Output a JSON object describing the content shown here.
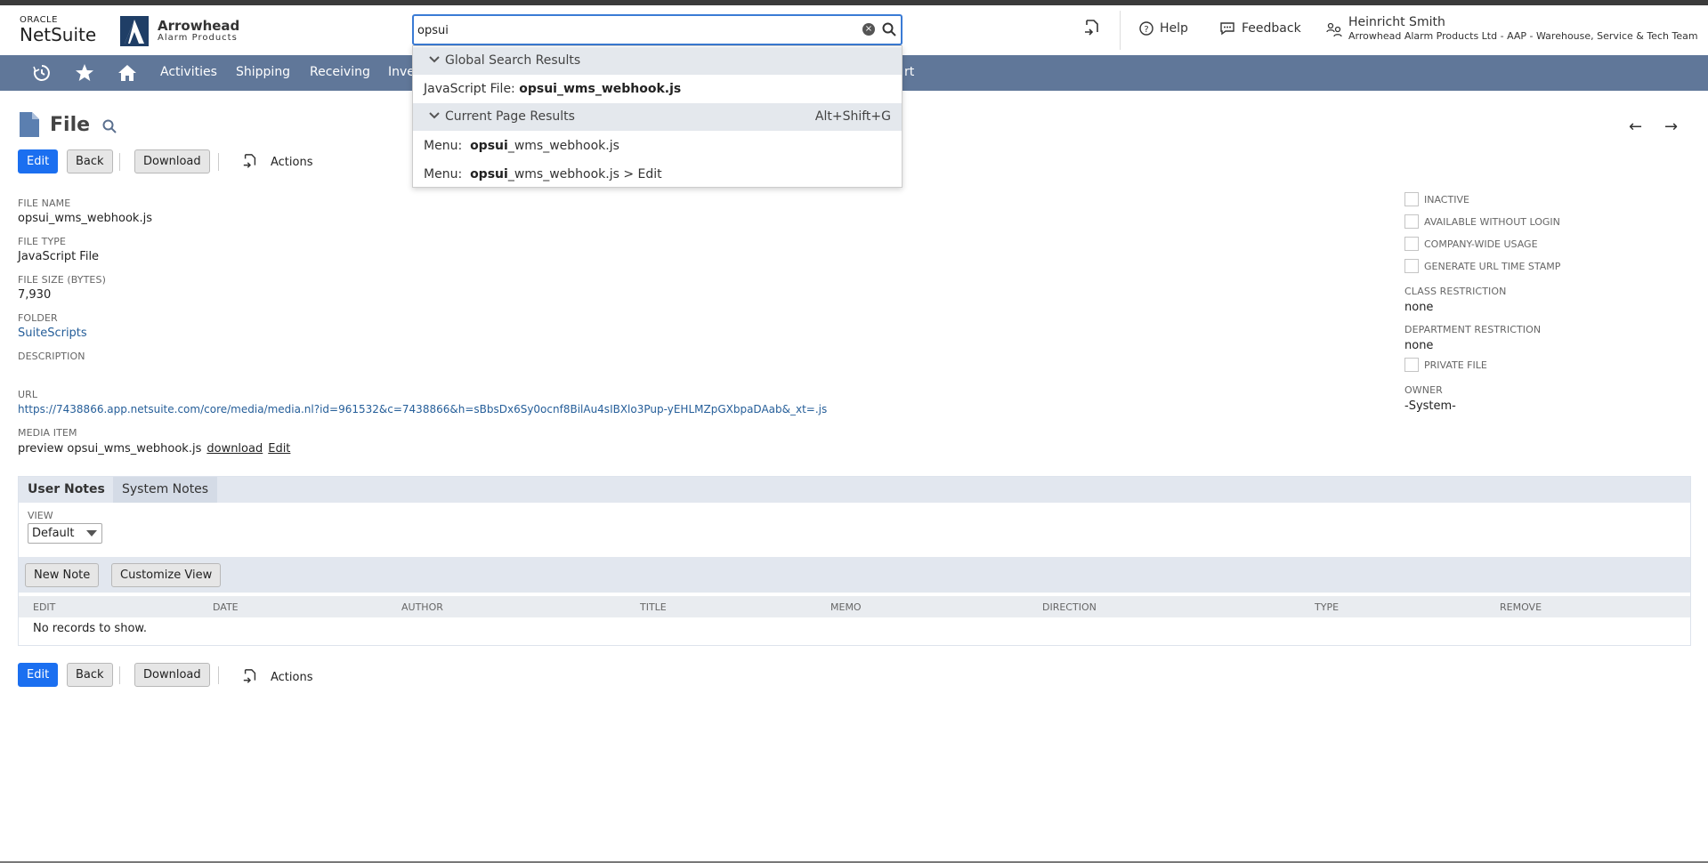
{
  "brand": {
    "oracle": "ORACLE",
    "netsuite": "NetSuite",
    "company_name": "Arrowhead",
    "company_sub": "Alarm Products"
  },
  "search": {
    "value": "opsui"
  },
  "header": {
    "help": "Help",
    "feedback": "Feedback",
    "user_name": "Heinricht Smith",
    "user_role": "Arrowhead Alarm Products Ltd - AAP - Warehouse, Service & Tech Team"
  },
  "nav": {
    "items": [
      "Activities",
      "Shipping",
      "Receiving",
      "Inve",
      "rt"
    ]
  },
  "dropdown": {
    "global_title": "Global Search Results",
    "global_item_prefix": "JavaScript File: ",
    "global_item_bold": "opsui_wms_webhook.js",
    "current_title": "Current Page Results",
    "current_shortcut": "Alt+Shift+G",
    "item1_prefix": "Menu: ",
    "item1_bold": "opsui",
    "item1_rest": "_wms_webhook.js",
    "item2_prefix": "Menu: ",
    "item2_bold": "opsui",
    "item2_rest": "_wms_webhook.js > Edit"
  },
  "page": {
    "title": "File"
  },
  "toolbar": {
    "edit": "Edit",
    "back": "Back",
    "download": "Download",
    "actions": "Actions"
  },
  "fields": {
    "file_name_label": "FILE NAME",
    "file_name": "opsui_wms_webhook.js",
    "file_type_label": "FILE TYPE",
    "file_type": "JavaScript File",
    "file_size_label": "FILE SIZE (BYTES)",
    "file_size": "7,930",
    "folder_label": "FOLDER",
    "folder": "SuiteScripts",
    "description_label": "DESCRIPTION",
    "url_label": "URL",
    "url": "https://7438866.app.netsuite.com/core/media/media.nl?id=961532&c=7438866&h=sBbsDx6Sy0ocnf8BilAu4sIBXlo3Pup-yEHLMZpGXbpaDAab&_xt=.js",
    "media_item_label": "MEDIA ITEM",
    "media_preview": "preview opsui_wms_webhook.js",
    "media_download": "download",
    "media_edit": "Edit"
  },
  "right_fields": {
    "inactive": "INACTIVE",
    "available_without_login": "AVAILABLE WITHOUT LOGIN",
    "company_wide_usage": "COMPANY-WIDE USAGE",
    "generate_url_time_stamp": "GENERATE URL TIME STAMP",
    "class_restriction_label": "CLASS RESTRICTION",
    "class_restriction": "none",
    "department_restriction_label": "DEPARTMENT RESTRICTION",
    "department_restriction": "none",
    "private_file": "PRIVATE FILE",
    "owner_label": "OWNER",
    "owner": "-System-"
  },
  "notes": {
    "tab_user": "User Notes",
    "tab_system": "System Notes",
    "view_label": "VIEW",
    "view_value": "Default",
    "new_note": "New Note",
    "customize_view": "Customize View",
    "columns": [
      "EDIT",
      "DATE",
      "AUTHOR",
      "TITLE",
      "MEMO",
      "DIRECTION",
      "TYPE",
      "REMOVE"
    ],
    "empty": "No records to show."
  },
  "colors": {
    "nav_bg": "#607799",
    "primary_button": "#1b6ff0",
    "link": "#255e99"
  }
}
